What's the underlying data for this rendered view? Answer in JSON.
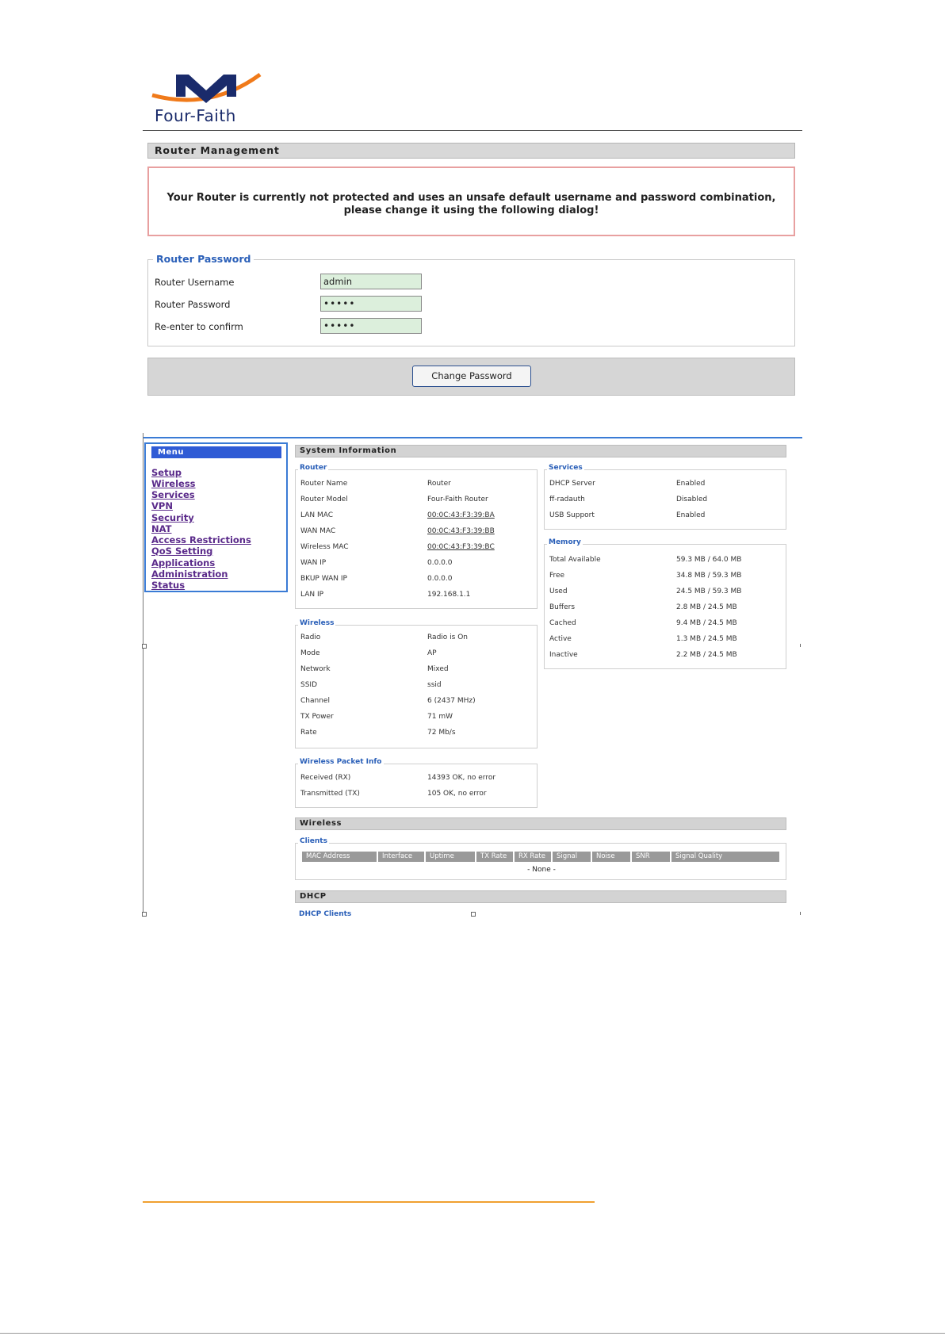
{
  "brand": {
    "name": "Four-Faith"
  },
  "router_management": {
    "bar_title": "Router Management",
    "warning": "Your Router is currently not protected and uses an unsafe default username and password combination, please change it using the following dialog!",
    "fieldset_title": "Router Password",
    "fields": [
      {
        "label": "Router Username",
        "value": "admin"
      },
      {
        "label": "Router Password",
        "value": "•••••"
      },
      {
        "label": "Re-enter to confirm",
        "value": "•••••"
      }
    ],
    "button": "Change Password"
  },
  "menu": {
    "title": "Menu",
    "items": [
      "Setup",
      "Wireless",
      "Services",
      "VPN",
      "Security",
      "NAT",
      "Access Restrictions",
      "QoS Setting",
      "Applications",
      "Administration",
      "Status"
    ]
  },
  "system_info": {
    "bar_title": "System Information",
    "router": {
      "title": "Router",
      "rows": [
        {
          "label": "Router Name",
          "value": "Router"
        },
        {
          "label": "Router Model",
          "value": "Four-Faith Router"
        },
        {
          "label": "LAN MAC",
          "value": "00:0C:43:F3:39:BA"
        },
        {
          "label": "WAN MAC",
          "value": "00:0C:43:F3:39:BB"
        },
        {
          "label": "Wireless MAC",
          "value": "00:0C:43:F3:39:BC"
        },
        {
          "label": "WAN IP",
          "value": "0.0.0.0"
        },
        {
          "label": "BKUP WAN IP",
          "value": "0.0.0.0"
        },
        {
          "label": "LAN IP",
          "value": "192.168.1.1"
        }
      ]
    },
    "services": {
      "title": "Services",
      "rows": [
        {
          "label": "DHCP Server",
          "value": "Enabled"
        },
        {
          "label": "ff-radauth",
          "value": "Disabled"
        },
        {
          "label": "USB Support",
          "value": "Enabled"
        }
      ]
    },
    "memory": {
      "title": "Memory",
      "rows": [
        {
          "label": "Total Available",
          "value": "59.3 MB / 64.0 MB"
        },
        {
          "label": "Free",
          "value": "34.8 MB / 59.3 MB"
        },
        {
          "label": "Used",
          "value": "24.5 MB / 59.3 MB"
        },
        {
          "label": "Buffers",
          "value": "2.8 MB / 24.5 MB"
        },
        {
          "label": "Cached",
          "value": "9.4 MB / 24.5 MB"
        },
        {
          "label": "Active",
          "value": "1.3 MB / 24.5 MB"
        },
        {
          "label": "Inactive",
          "value": "2.2 MB / 24.5 MB"
        }
      ]
    },
    "wireless": {
      "title": "Wireless",
      "rows": [
        {
          "label": "Radio",
          "value": "Radio is On"
        },
        {
          "label": "Mode",
          "value": "AP"
        },
        {
          "label": "Network",
          "value": "Mixed"
        },
        {
          "label": "SSID",
          "value": "ssid"
        },
        {
          "label": "Channel",
          "value": "6 (2437 MHz)"
        },
        {
          "label": "TX Power",
          "value": "71 mW"
        },
        {
          "label": "Rate",
          "value": "72 Mb/s"
        }
      ]
    },
    "packet_info": {
      "title": "Wireless Packet Info",
      "rows": [
        {
          "label": "Received (RX)",
          "value": "14393 OK, no error"
        },
        {
          "label": "Transmitted (TX)",
          "value": "105 OK, no error"
        }
      ]
    }
  },
  "wireless_section": {
    "bar_title": "Wireless",
    "clients_title": "Clients",
    "columns": [
      "MAC Address",
      "Interface",
      "Uptime",
      "TX Rate",
      "RX Rate",
      "Signal",
      "Noise",
      "SNR",
      "Signal Quality"
    ],
    "empty": "- None -"
  },
  "dhcp_section": {
    "bar_title": "DHCP",
    "clients_title": "DHCP Clients"
  }
}
